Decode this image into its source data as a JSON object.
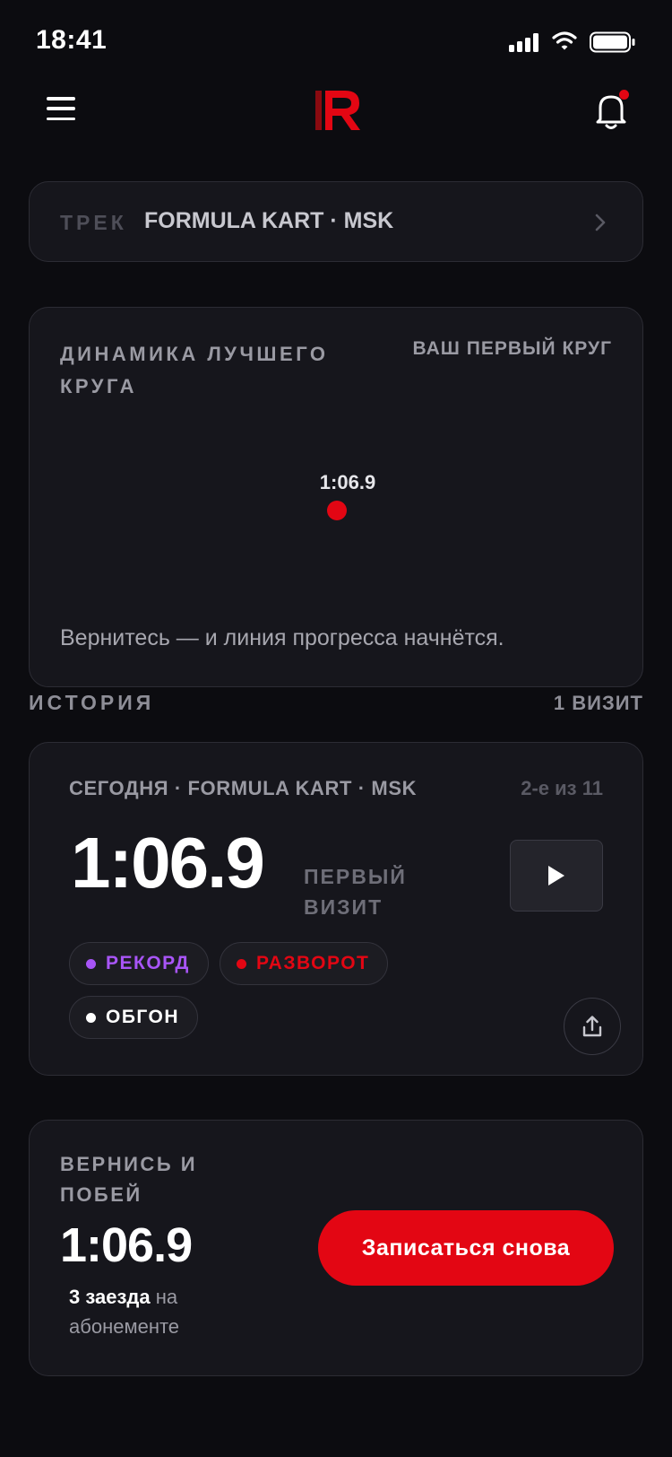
{
  "status_bar": {
    "time": "18:41"
  },
  "header": {
    "logo_icon": "brand-r-logo",
    "menu_icon": "hamburger-icon",
    "bell_icon": "bell-icon",
    "has_notification": true
  },
  "track": {
    "label": "ТРЕК",
    "value": "FORMULA KART · MSK"
  },
  "progress_chart": {
    "title": "ДИНАМИКА ЛУЧШЕГО КРУГА",
    "subtitle": "ВАШ ПЕРВЫЙ КРУГ",
    "point_label": "1:06.9",
    "hint": "Вернитесь — и линия прогресса начнётся."
  },
  "chart_data": {
    "type": "scatter",
    "title": "ДИНАМИКА ЛУЧШЕГО КРУГА",
    "series": [
      {
        "values": [
          "1:06.9"
        ]
      }
    ],
    "point_color": "#e30613"
  },
  "history": {
    "label": "ИСТОРИЯ",
    "count": "1 ВИЗИТ"
  },
  "visit": {
    "header": "СЕГОДНЯ · FORMULA KART · MSK",
    "rank": "2-е из 11",
    "lap_time": "1:06.9",
    "first_visit": "ПЕРВЫЙ ВИЗИТ",
    "tags": [
      {
        "label": "РЕКОРД",
        "color": "#a855f7"
      },
      {
        "label": "РАЗВОРОТ",
        "color": "#e30613"
      },
      {
        "label": "ОБГОН",
        "color": "#ffffff"
      }
    ]
  },
  "cta": {
    "title": "ВЕРНИСЬ И ПОБЕЙ",
    "lap_time": "1:06.9",
    "rides": "3 заезда",
    "rides_suffix": "на абонементе",
    "button": "Записаться снова"
  },
  "colors": {
    "accent": "#e30613",
    "background": "#0c0c10",
    "card": "#16161c"
  }
}
